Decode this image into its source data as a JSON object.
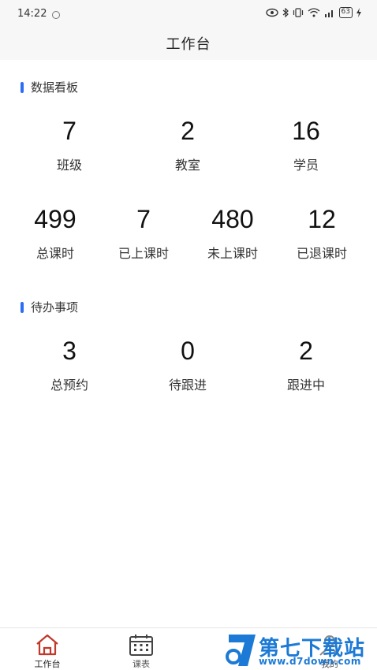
{
  "status_bar": {
    "time": "14:22",
    "battery": "63"
  },
  "header": {
    "title": "工作台"
  },
  "dashboard": {
    "section_title": "数据看板",
    "row1": [
      {
        "value": "7",
        "label": "班级"
      },
      {
        "value": "2",
        "label": "教室"
      },
      {
        "value": "16",
        "label": "学员"
      }
    ],
    "row2": [
      {
        "value": "499",
        "label": "总课时"
      },
      {
        "value": "7",
        "label": "已上课时"
      },
      {
        "value": "480",
        "label": "未上课时"
      },
      {
        "value": "12",
        "label": "已退课时"
      }
    ]
  },
  "todo": {
    "section_title": "待办事项",
    "items": [
      {
        "value": "3",
        "label": "总预约"
      },
      {
        "value": "0",
        "label": "待跟进"
      },
      {
        "value": "2",
        "label": "跟进中"
      }
    ]
  },
  "tabbar": {
    "tabs": [
      {
        "label": "工作台",
        "icon": "home-icon",
        "active": true
      },
      {
        "label": "课表",
        "icon": "calendar-icon",
        "active": false
      },
      {
        "label": "我的",
        "icon": "user-icon",
        "active": false
      }
    ]
  },
  "watermark": {
    "text": "第七下载站",
    "url": "www.d7down.com"
  },
  "colors": {
    "accent": "#2c6cf6",
    "home_icon": "#c0392b",
    "watermark": "#1c7ad6"
  }
}
